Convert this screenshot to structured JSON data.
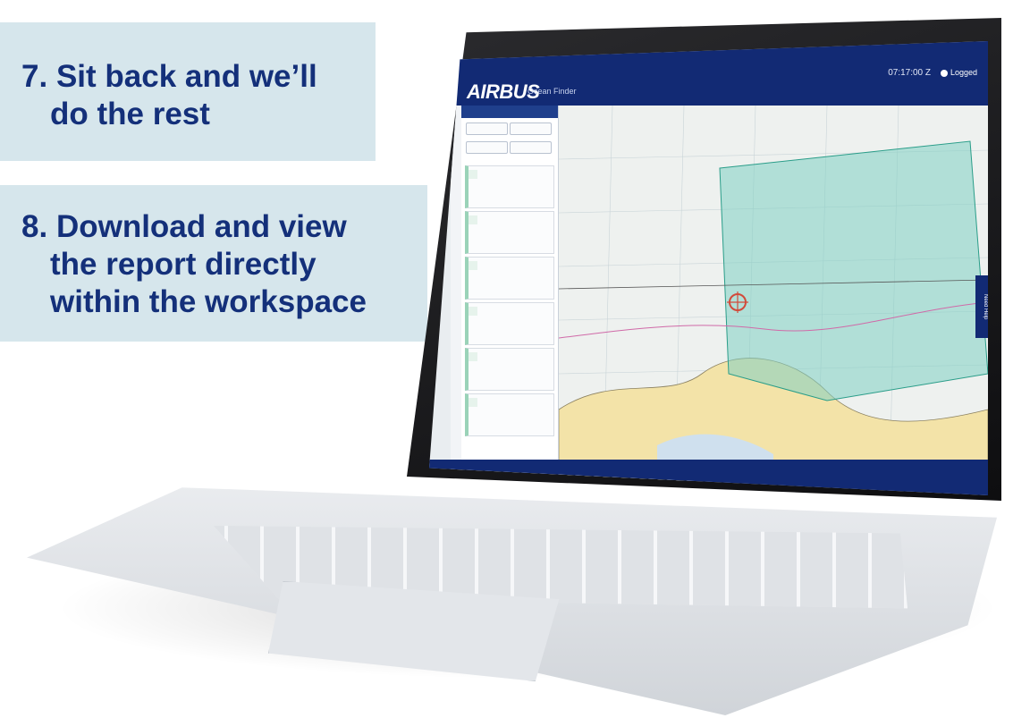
{
  "steps": [
    {
      "number": "7.",
      "line1": "Sit back and we’ll",
      "line2": "do the rest"
    },
    {
      "number": "8.",
      "line1": "Download and view",
      "line2": "the report directly",
      "line3": "within the workspace"
    }
  ],
  "app": {
    "brand": "AIRBUS",
    "subtitle": "Ocean Finder",
    "clock": "07:17:00 Z",
    "user_label": "Logged",
    "help_tab": "Need Help"
  },
  "colors": {
    "brand_navy": "#122a74",
    "step_panel": "#d6e6ec",
    "title_text": "#14307a"
  }
}
